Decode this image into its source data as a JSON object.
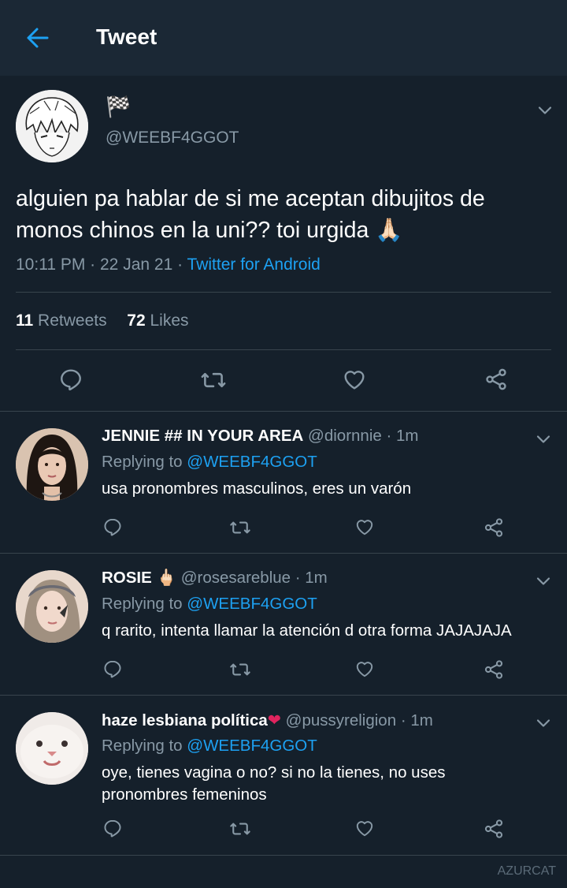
{
  "header": {
    "title": "Tweet"
  },
  "tweet": {
    "name_emoji": "🏁",
    "handle": "@WEEBF4GGOT",
    "text_line1": "alguien pa hablar de si me aceptan dibujitos de",
    "text_line2": "monos chinos en la uni?? toi urgida",
    "text_emoji": "🙏🏻",
    "time": "10:11 PM",
    "sep1": " · ",
    "date": "22 Jan 21",
    "sep2": " · ",
    "source": "Twitter for Android",
    "retweets_count": "11",
    "retweets_label": "Retweets",
    "likes_count": "72",
    "likes_label": "Likes"
  },
  "replies": [
    {
      "name": "JENNIE ## IN YOUR AREA",
      "name_emoji": "",
      "handle": "@diornnie",
      "time": " · 1m",
      "replying_label": "Replying to",
      "replying_handle": "@WEEBF4GGOT",
      "text_lines": [
        "usa pronombres masculinos, eres un varón"
      ]
    },
    {
      "name": "ROSIE",
      "name_emoji": "🖕🏻",
      "handle": "@rosesareblue",
      "time": " · 1m",
      "replying_label": "Replying to",
      "replying_handle": "@WEEBF4GGOT",
      "text_lines": [
        "q rarito, intenta llamar la atención d otra forma JAJAJAJA"
      ]
    },
    {
      "name": "haze lesbiana política",
      "name_emoji": "❤",
      "handle": "@pussyreligion",
      "time": " · 1m",
      "replying_label": "Replying to",
      "replying_handle": "@WEEBF4GGOT",
      "text_lines": [
        "oye, tienes vagina o no? si no la tienes, no uses",
        "pronombres femeninos"
      ]
    }
  ],
  "watermark": "AZURCAT",
  "colors": {
    "background": "#15202b",
    "header": "#1b2835",
    "accent": "#1da1f2",
    "muted": "#8899a6",
    "divider": "#38444d",
    "heart": "#e0245e"
  },
  "icons": [
    "back-arrow-icon",
    "chevron-down-icon",
    "reply-icon",
    "retweet-icon",
    "like-icon",
    "share-icon"
  ]
}
